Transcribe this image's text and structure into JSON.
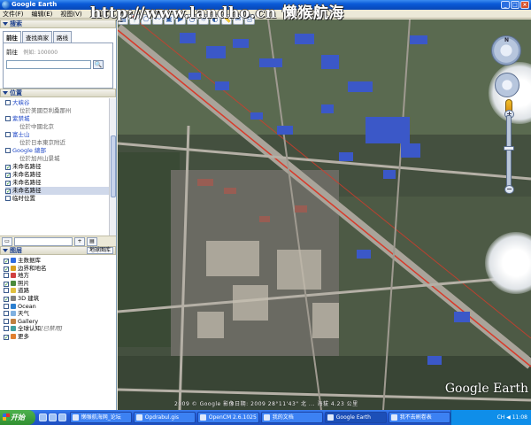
{
  "window": {
    "title": "Google Earth"
  },
  "menu": [
    "文件(F)",
    "编辑(E)",
    "视图(V)",
    "工具(T)",
    "添加(A)",
    "帮助(H)"
  ],
  "watermark": "http://www.landho.cn  懒猴航海",
  "toolbar_icons": [
    "hide-sidebar-icon",
    "placemark-icon",
    "polygon-icon",
    "path-icon",
    "overlay-icon",
    "tour-icon",
    "history-icon",
    "sun-icon",
    "planets-icon",
    "ruler-icon",
    "email-icon",
    "print-icon"
  ],
  "search": {
    "header": "搜索",
    "tabs": [
      "前往",
      "查找商家",
      "路线"
    ],
    "fly_label": "前往",
    "fly_example": "例如: 100000",
    "input_value": "",
    "search_button": "🔍"
  },
  "places": {
    "header": "位置",
    "items": [
      {
        "title": "大峡谷",
        "subtitle": "位於美國亞利桑那州",
        "checked": false,
        "kind": "link"
      },
      {
        "title": "紫禁城",
        "subtitle": "位於中國北京",
        "checked": false,
        "kind": "link"
      },
      {
        "title": "富士山",
        "subtitle": "位於日本東京附近",
        "checked": false,
        "kind": "link"
      },
      {
        "title": "Google 總部",
        "subtitle": "位於加州山景城",
        "checked": false,
        "kind": "link"
      },
      {
        "title": "未命名路径",
        "subtitle": "",
        "checked": true,
        "kind": "path"
      },
      {
        "title": "未命名路径",
        "subtitle": "",
        "checked": true,
        "kind": "path"
      },
      {
        "title": "未命名路径",
        "subtitle": "",
        "checked": true,
        "kind": "path"
      },
      {
        "title": "未命名路径",
        "subtitle": "",
        "checked": true,
        "kind": "path",
        "selected": true
      },
      {
        "title": "临时位置",
        "subtitle": "",
        "checked": false,
        "kind": "folder"
      }
    ]
  },
  "places_tools": [
    "▭",
    "+",
    "▤"
  ],
  "layers": {
    "header": "图层",
    "gallery_button": "地球图库",
    "items": [
      {
        "label": "主数据库",
        "checked": true,
        "icon_color": "#2f6be0"
      },
      {
        "label": "边界和地名",
        "checked": true,
        "icon_color": "#d8a020"
      },
      {
        "label": "地方",
        "checked": false,
        "icon_color": "#d04040"
      },
      {
        "label": "照片",
        "checked": true,
        "icon_color": "#4a8a3a"
      },
      {
        "label": "道路",
        "checked": false,
        "icon_color": "#e0c040"
      },
      {
        "label": "3D 建筑",
        "checked": true,
        "icon_color": "#808080"
      },
      {
        "label": "Ocean",
        "checked": false,
        "icon_color": "#2b7fd0"
      },
      {
        "label": "天气",
        "checked": false,
        "icon_color": "#7fb0e0"
      },
      {
        "label": "Gallery",
        "checked": false,
        "icon_color": "#c08040"
      },
      {
        "label": "全球认知",
        "note": "[已禁用]",
        "checked": false,
        "icon_color": "#40a0a0"
      },
      {
        "label": "更多",
        "checked": true,
        "icon_color": "#e08030"
      }
    ]
  },
  "map": {
    "logo": "Google Earth",
    "status": "2009 © Google   影像日期: 2009   28°11'43\" 北   ...   海拔  4.23 公里"
  },
  "taskbar": {
    "start": "开始",
    "items": [
      "懒猴航海网_论坛",
      "Opdrabul.gis",
      "OpenCM 2.6.1025",
      "我的文档",
      "Google Earth",
      "我不去刷卷表"
    ],
    "active_index": 4,
    "clock": "CH  ◀ 11:08"
  },
  "colors": {
    "titlebar": "#0a5ad8",
    "taskbar": "#245edb",
    "path_line": "#d83a2a"
  }
}
